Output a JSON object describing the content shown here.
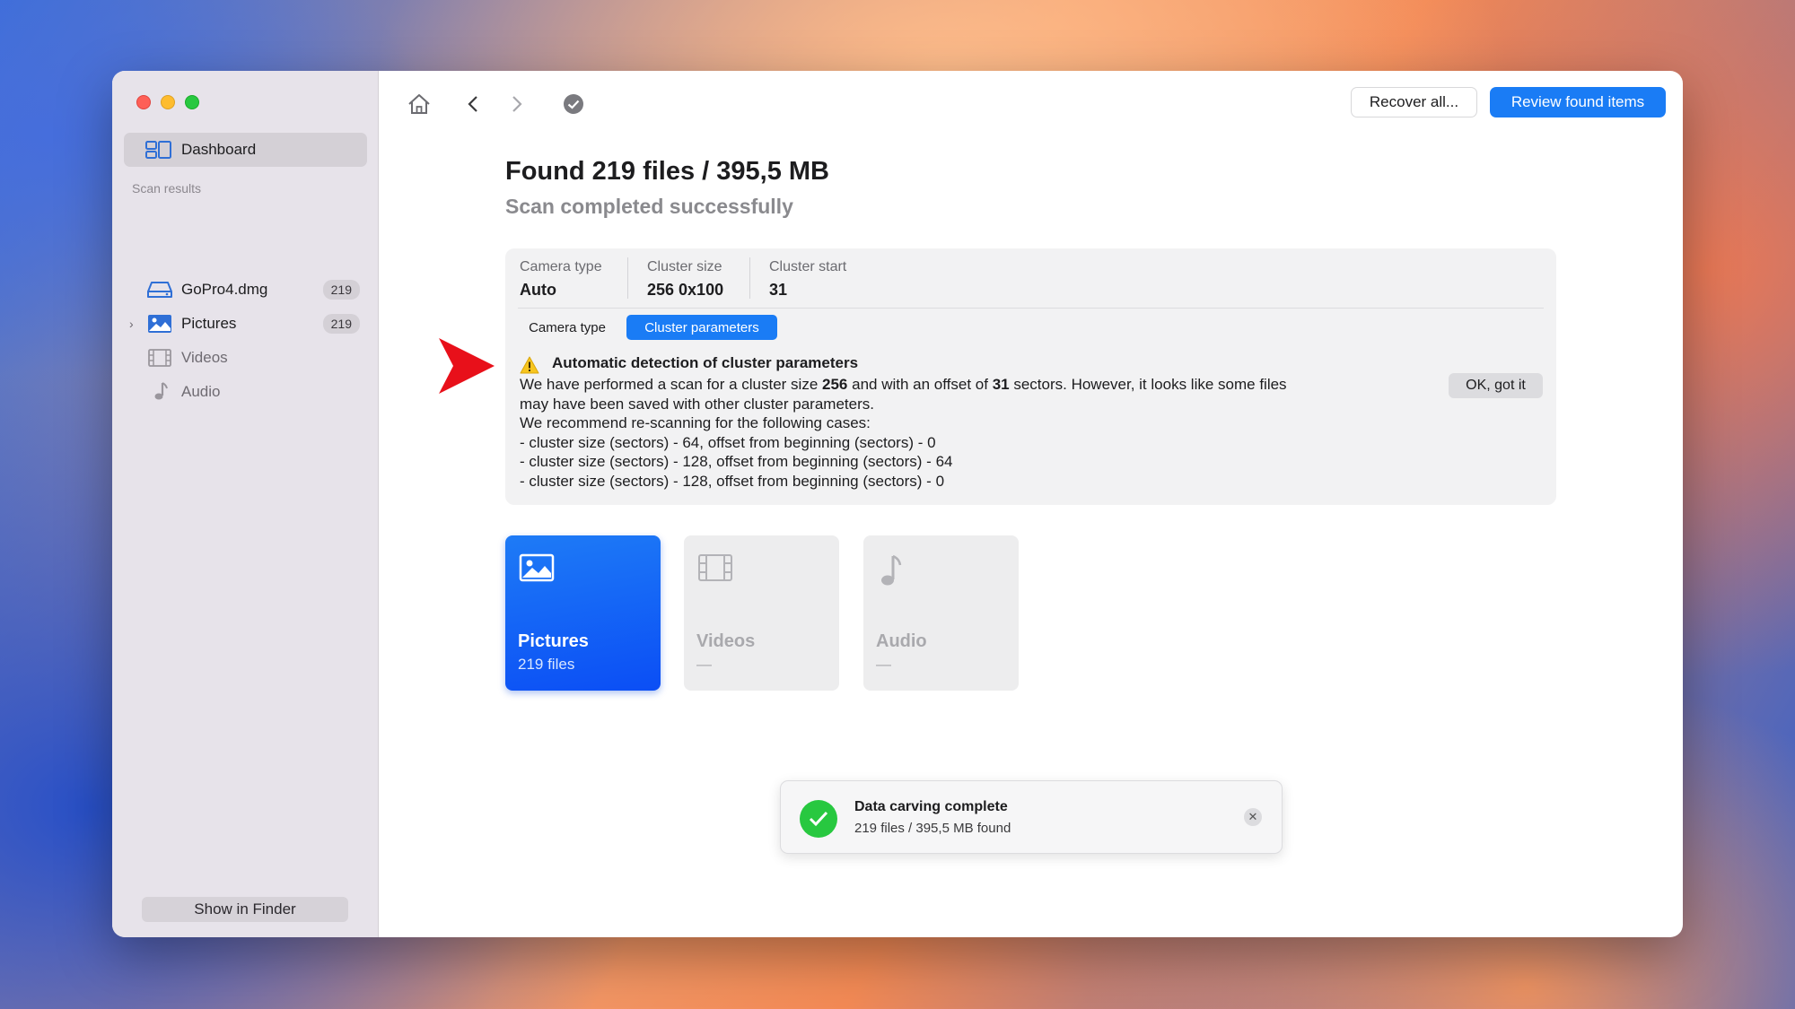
{
  "sidebar": {
    "dashboard_label": "Dashboard",
    "section_label": "Scan results",
    "items": [
      {
        "label": "GoPro4.dmg",
        "badge": "219",
        "icon": "disk-icon"
      },
      {
        "label": "Pictures",
        "badge": "219",
        "icon": "picture-icon",
        "expandable": true
      },
      {
        "label": "Videos",
        "icon": "film-icon"
      },
      {
        "label": "Audio",
        "icon": "music-note-icon"
      }
    ],
    "show_in_finder": "Show in Finder"
  },
  "toolbar": {
    "recover_all": "Recover all...",
    "review_found": "Review found items"
  },
  "main": {
    "title": "Found 219 files / 395,5 MB",
    "subtitle": "Scan completed successfully"
  },
  "params": {
    "camera_type": {
      "label": "Camera type",
      "value": "Auto"
    },
    "cluster_size": {
      "label": "Cluster size",
      "value": "256 0x100"
    },
    "cluster_start": {
      "label": "Cluster start",
      "value": "31"
    }
  },
  "tabs": {
    "camera_type": "Camera type",
    "cluster_parameters": "Cluster parameters"
  },
  "warning": {
    "title": "Automatic detection of cluster parameters",
    "line1_a": "We have performed a scan for a cluster size ",
    "line1_b": "256",
    "line1_c": " and with an offset of ",
    "line1_d": "31",
    "line1_e": " sectors. However, it looks like some files",
    "line2": "may have been saved with other cluster parameters.",
    "line3": "We recommend re-scanning for the following cases:",
    "cases": [
      "- cluster size (sectors) - 64, offset from beginning (sectors) - 0",
      "- cluster size (sectors) - 128, offset from beginning (sectors) - 64",
      "- cluster size (sectors) - 128, offset from beginning (sectors) - 0"
    ],
    "ok_button": "OK, got it"
  },
  "cards": [
    {
      "name": "Pictures",
      "count": "219 files"
    },
    {
      "name": "Videos",
      "count": "—"
    },
    {
      "name": "Audio",
      "count": "—"
    }
  ],
  "toast": {
    "title": "Data carving complete",
    "detail": "219 files / 395,5 MB found"
  },
  "colors": {
    "accent": "#1a7cf5",
    "success": "#28c840",
    "annotation_arrow": "#e8101a"
  }
}
